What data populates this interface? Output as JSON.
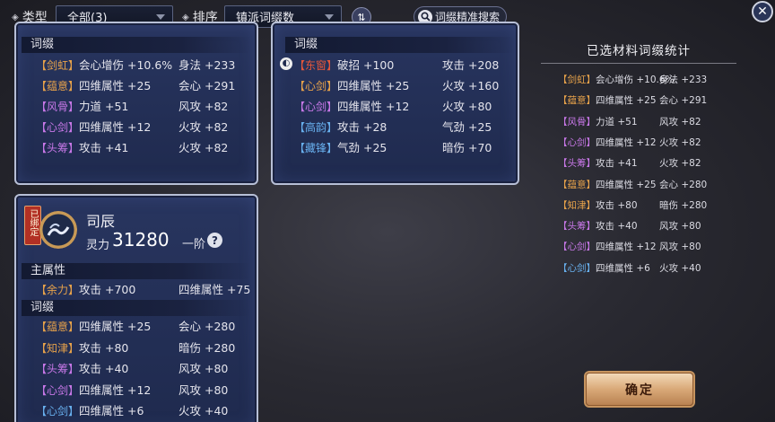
{
  "filters": {
    "type_label": "类型",
    "type_value": "全部(3)",
    "sort_label": "排序",
    "sort_value": "镇派词缀数",
    "sort_toggle": "⇅",
    "search_label": "词缀精准搜索",
    "close": "✕"
  },
  "card1": {
    "section": "词缀",
    "rows": [
      {
        "tag": "【剑虹】",
        "color": "#e7a24a",
        "left": "会心增伤 +10.6%",
        "right": "身法 +233"
      },
      {
        "tag": "【蕴意】",
        "color": "#e7a24a",
        "left": "四维属性 +25",
        "right": "会心 +291"
      },
      {
        "tag": "【风骨】",
        "color": "#c878e8",
        "left": "力道 +51",
        "right": "风攻 +82"
      },
      {
        "tag": "【心剑】",
        "color": "#c878e8",
        "left": "四维属性 +12",
        "right": "火攻 +82"
      },
      {
        "tag": "【头筹】",
        "color": "#c878e8",
        "left": "攻击 +41",
        "right": "火攻 +82"
      }
    ]
  },
  "card2": {
    "section": "词缀",
    "rows": [
      {
        "tag": "【东窗】",
        "color": "#e6573a",
        "left": "破招 +100",
        "right": "攻击 +208"
      },
      {
        "tag": "【心剑】",
        "color": "#e7a24a",
        "left": "四维属性 +25",
        "right": "火攻 +160"
      },
      {
        "tag": "【心剑】",
        "color": "#c878e8",
        "left": "四维属性 +12",
        "right": "火攻 +80"
      },
      {
        "tag": "【高韵】",
        "color": "#68b0ee",
        "left": "攻击 +28",
        "right": "气劲 +25"
      },
      {
        "tag": "【藏锋】",
        "color": "#68b0ee",
        "left": "气劲 +25",
        "right": "暗伤 +70"
      }
    ]
  },
  "card3": {
    "seal": "已绑定",
    "name": "司辰",
    "power_label": "灵力",
    "power_value": "31280",
    "tier": "一阶",
    "main_section": "主属性",
    "main_row": {
      "tag": "【余力】",
      "color": "#e7a24a",
      "left": "攻击 +700",
      "right": "四维属性 +75"
    },
    "section": "词缀",
    "rows": [
      {
        "tag": "【蕴意】",
        "color": "#e7a24a",
        "left": "四维属性 +25",
        "right": "会心 +280"
      },
      {
        "tag": "【知津】",
        "color": "#e7a24a",
        "left": "攻击 +80",
        "right": "暗伤 +280"
      },
      {
        "tag": "【头筹】",
        "color": "#c878e8",
        "left": "攻击 +40",
        "right": "风攻 +80"
      },
      {
        "tag": "【心剑】",
        "color": "#c878e8",
        "left": "四维属性 +12",
        "right": "风攻 +80"
      },
      {
        "tag": "【心剑】",
        "color": "#68b0ee",
        "left": "四维属性 +6",
        "right": "火攻 +40"
      }
    ]
  },
  "stats": {
    "title": "已选材料词缀统计",
    "rows": [
      {
        "tag": "【剑虹】",
        "color": "#e7a24a",
        "left": "会心增伤 +10.6%",
        "right": "身法 +233"
      },
      {
        "tag": "【蕴意】",
        "color": "#e7a24a",
        "left": "四维属性 +25",
        "right": "会心 +291"
      },
      {
        "tag": "【风骨】",
        "color": "#c878e8",
        "left": "力道 +51",
        "right": "风攻 +82"
      },
      {
        "tag": "【心剑】",
        "color": "#c878e8",
        "left": "四维属性 +12",
        "right": "火攻 +82"
      },
      {
        "tag": "【头筹】",
        "color": "#c878e8",
        "left": "攻击 +41",
        "right": "火攻 +82"
      },
      {
        "tag": "【蕴意】",
        "color": "#e7a24a",
        "left": "四维属性 +25",
        "right": "会心 +280"
      },
      {
        "tag": "【知津】",
        "color": "#e7a24a",
        "left": "攻击 +80",
        "right": "暗伤 +280"
      },
      {
        "tag": "【头筹】",
        "color": "#c878e8",
        "left": "攻击 +40",
        "right": "风攻 +80"
      },
      {
        "tag": "【心剑】",
        "color": "#c878e8",
        "left": "四维属性 +12",
        "right": "风攻 +80"
      },
      {
        "tag": "【心剑】",
        "color": "#68b0ee",
        "left": "四维属性 +6",
        "right": "火攻 +40"
      }
    ]
  },
  "confirm_label": "确定"
}
